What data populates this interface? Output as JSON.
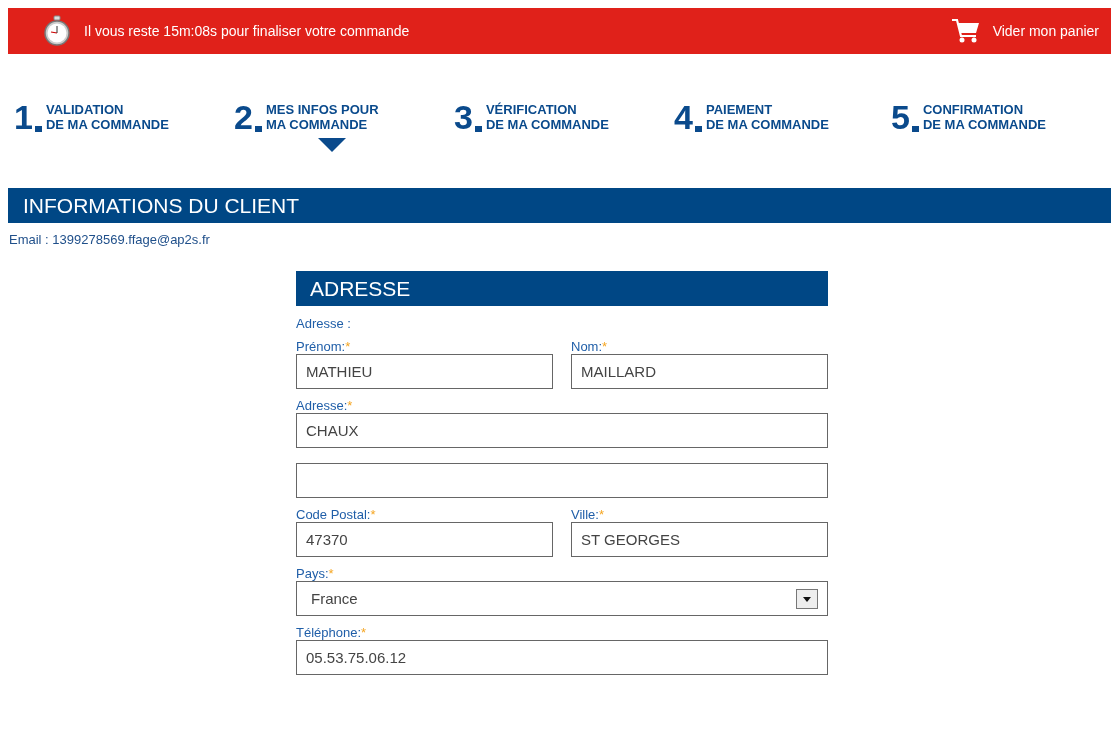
{
  "timer_bar": {
    "message": "Il vous reste 15m:08s pour finaliser votre commande",
    "empty_cart": "Vider mon panier"
  },
  "steps": [
    {
      "number": "1",
      "title": "VALIDATION",
      "subtitle": "DE MA COMMANDE",
      "selected": false
    },
    {
      "number": "2",
      "title": "MES INFOS POUR",
      "subtitle": "MA COMMANDE",
      "selected": true
    },
    {
      "number": "3",
      "title": "VÉRIFICATION",
      "subtitle": "DE MA COMMANDE",
      "selected": false
    },
    {
      "number": "4",
      "title": "PAIEMENT",
      "subtitle": "DE MA COMMANDE",
      "selected": false
    },
    {
      "number": "5",
      "title": "CONFIRMATION",
      "subtitle": "DE MA COMMANDE",
      "selected": false
    }
  ],
  "client": {
    "title": "INFORMATIONS DU CLIENT",
    "email": "Email : 1399278569.ffage@ap2s.fr"
  },
  "address": {
    "title": "ADRESSE",
    "caption": "Adresse :",
    "rows": [
      [
        {
          "kind": "text",
          "label": "Prénom:",
          "mark": "*",
          "value": "MATHIEU"
        },
        {
          "kind": "text",
          "label": "Nom:",
          "mark": "*",
          "value": "MAILLARD"
        }
      ],
      [
        {
          "kind": "text",
          "label": "Adresse:",
          "mark": "*",
          "value": "CHAUX"
        }
      ],
      [
        {
          "kind": "text"
        }
      ],
      [
        {
          "kind": "text",
          "label": "Code Postal:",
          "mark": "*",
          "value": "47370"
        },
        {
          "kind": "text",
          "label": "Ville:",
          "mark": "*",
          "value": "ST GEORGES"
        }
      ],
      [
        {
          "kind": "select",
          "label": "Pays:",
          "mark": "*",
          "value": "France"
        }
      ],
      [
        {
          "kind": "text",
          "label": "Téléphone:",
          "mark": "*",
          "value": "05.53.75.06.12"
        }
      ]
    ]
  }
}
